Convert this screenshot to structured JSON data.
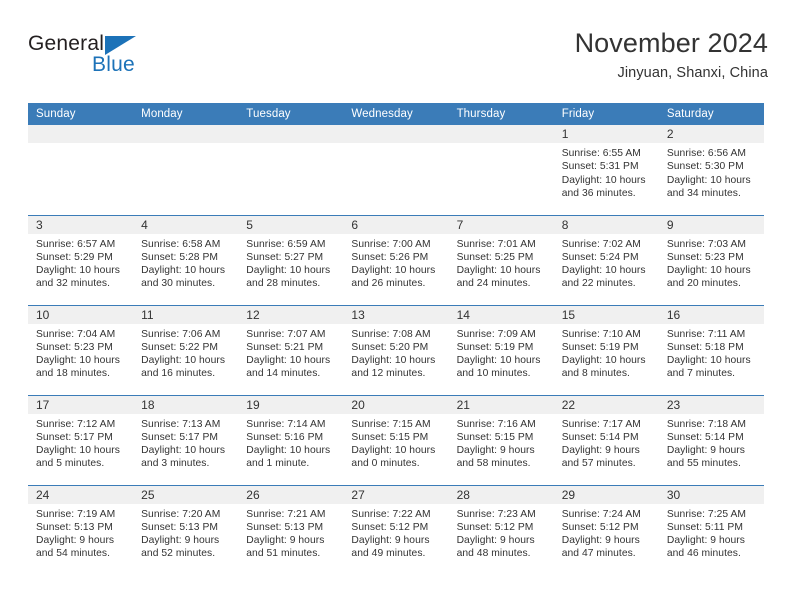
{
  "brand": {
    "name_part1": "General",
    "name_part2": "Blue",
    "flag_icon": "triangle-flag-icon",
    "colors": {
      "blue": "#1c72b8",
      "dark": "#231f20"
    }
  },
  "header": {
    "title": "November 2024",
    "subtitle": "Jinyuan, Shanxi, China"
  },
  "calendar": {
    "header_bg": "#3b7cb8",
    "daynum_bg": "#f0f0f0",
    "weekday_names": [
      "Sunday",
      "Monday",
      "Tuesday",
      "Wednesday",
      "Thursday",
      "Friday",
      "Saturday"
    ],
    "weeks": [
      [
        {
          "day": "",
          "sunrise": "",
          "sunset": "",
          "daylight": "",
          "empty": true
        },
        {
          "day": "",
          "sunrise": "",
          "sunset": "",
          "daylight": "",
          "empty": true
        },
        {
          "day": "",
          "sunrise": "",
          "sunset": "",
          "daylight": "",
          "empty": true
        },
        {
          "day": "",
          "sunrise": "",
          "sunset": "",
          "daylight": "",
          "empty": true
        },
        {
          "day": "",
          "sunrise": "",
          "sunset": "",
          "daylight": "",
          "empty": true
        },
        {
          "day": "1",
          "sunrise": "Sunrise: 6:55 AM",
          "sunset": "Sunset: 5:31 PM",
          "daylight": "Daylight: 10 hours and 36 minutes.",
          "empty": false
        },
        {
          "day": "2",
          "sunrise": "Sunrise: 6:56 AM",
          "sunset": "Sunset: 5:30 PM",
          "daylight": "Daylight: 10 hours and 34 minutes.",
          "empty": false
        }
      ],
      [
        {
          "day": "3",
          "sunrise": "Sunrise: 6:57 AM",
          "sunset": "Sunset: 5:29 PM",
          "daylight": "Daylight: 10 hours and 32 minutes.",
          "empty": false
        },
        {
          "day": "4",
          "sunrise": "Sunrise: 6:58 AM",
          "sunset": "Sunset: 5:28 PM",
          "daylight": "Daylight: 10 hours and 30 minutes.",
          "empty": false
        },
        {
          "day": "5",
          "sunrise": "Sunrise: 6:59 AM",
          "sunset": "Sunset: 5:27 PM",
          "daylight": "Daylight: 10 hours and 28 minutes.",
          "empty": false
        },
        {
          "day": "6",
          "sunrise": "Sunrise: 7:00 AM",
          "sunset": "Sunset: 5:26 PM",
          "daylight": "Daylight: 10 hours and 26 minutes.",
          "empty": false
        },
        {
          "day": "7",
          "sunrise": "Sunrise: 7:01 AM",
          "sunset": "Sunset: 5:25 PM",
          "daylight": "Daylight: 10 hours and 24 minutes.",
          "empty": false
        },
        {
          "day": "8",
          "sunrise": "Sunrise: 7:02 AM",
          "sunset": "Sunset: 5:24 PM",
          "daylight": "Daylight: 10 hours and 22 minutes.",
          "empty": false
        },
        {
          "day": "9",
          "sunrise": "Sunrise: 7:03 AM",
          "sunset": "Sunset: 5:23 PM",
          "daylight": "Daylight: 10 hours and 20 minutes.",
          "empty": false
        }
      ],
      [
        {
          "day": "10",
          "sunrise": "Sunrise: 7:04 AM",
          "sunset": "Sunset: 5:23 PM",
          "daylight": "Daylight: 10 hours and 18 minutes.",
          "empty": false
        },
        {
          "day": "11",
          "sunrise": "Sunrise: 7:06 AM",
          "sunset": "Sunset: 5:22 PM",
          "daylight": "Daylight: 10 hours and 16 minutes.",
          "empty": false
        },
        {
          "day": "12",
          "sunrise": "Sunrise: 7:07 AM",
          "sunset": "Sunset: 5:21 PM",
          "daylight": "Daylight: 10 hours and 14 minutes.",
          "empty": false
        },
        {
          "day": "13",
          "sunrise": "Sunrise: 7:08 AM",
          "sunset": "Sunset: 5:20 PM",
          "daylight": "Daylight: 10 hours and 12 minutes.",
          "empty": false
        },
        {
          "day": "14",
          "sunrise": "Sunrise: 7:09 AM",
          "sunset": "Sunset: 5:19 PM",
          "daylight": "Daylight: 10 hours and 10 minutes.",
          "empty": false
        },
        {
          "day": "15",
          "sunrise": "Sunrise: 7:10 AM",
          "sunset": "Sunset: 5:19 PM",
          "daylight": "Daylight: 10 hours and 8 minutes.",
          "empty": false
        },
        {
          "day": "16",
          "sunrise": "Sunrise: 7:11 AM",
          "sunset": "Sunset: 5:18 PM",
          "daylight": "Daylight: 10 hours and 7 minutes.",
          "empty": false
        }
      ],
      [
        {
          "day": "17",
          "sunrise": "Sunrise: 7:12 AM",
          "sunset": "Sunset: 5:17 PM",
          "daylight": "Daylight: 10 hours and 5 minutes.",
          "empty": false
        },
        {
          "day": "18",
          "sunrise": "Sunrise: 7:13 AM",
          "sunset": "Sunset: 5:17 PM",
          "daylight": "Daylight: 10 hours and 3 minutes.",
          "empty": false
        },
        {
          "day": "19",
          "sunrise": "Sunrise: 7:14 AM",
          "sunset": "Sunset: 5:16 PM",
          "daylight": "Daylight: 10 hours and 1 minute.",
          "empty": false
        },
        {
          "day": "20",
          "sunrise": "Sunrise: 7:15 AM",
          "sunset": "Sunset: 5:15 PM",
          "daylight": "Daylight: 10 hours and 0 minutes.",
          "empty": false
        },
        {
          "day": "21",
          "sunrise": "Sunrise: 7:16 AM",
          "sunset": "Sunset: 5:15 PM",
          "daylight": "Daylight: 9 hours and 58 minutes.",
          "empty": false
        },
        {
          "day": "22",
          "sunrise": "Sunrise: 7:17 AM",
          "sunset": "Sunset: 5:14 PM",
          "daylight": "Daylight: 9 hours and 57 minutes.",
          "empty": false
        },
        {
          "day": "23",
          "sunrise": "Sunrise: 7:18 AM",
          "sunset": "Sunset: 5:14 PM",
          "daylight": "Daylight: 9 hours and 55 minutes.",
          "empty": false
        }
      ],
      [
        {
          "day": "24",
          "sunrise": "Sunrise: 7:19 AM",
          "sunset": "Sunset: 5:13 PM",
          "daylight": "Daylight: 9 hours and 54 minutes.",
          "empty": false
        },
        {
          "day": "25",
          "sunrise": "Sunrise: 7:20 AM",
          "sunset": "Sunset: 5:13 PM",
          "daylight": "Daylight: 9 hours and 52 minutes.",
          "empty": false
        },
        {
          "day": "26",
          "sunrise": "Sunrise: 7:21 AM",
          "sunset": "Sunset: 5:13 PM",
          "daylight": "Daylight: 9 hours and 51 minutes.",
          "empty": false
        },
        {
          "day": "27",
          "sunrise": "Sunrise: 7:22 AM",
          "sunset": "Sunset: 5:12 PM",
          "daylight": "Daylight: 9 hours and 49 minutes.",
          "empty": false
        },
        {
          "day": "28",
          "sunrise": "Sunrise: 7:23 AM",
          "sunset": "Sunset: 5:12 PM",
          "daylight": "Daylight: 9 hours and 48 minutes.",
          "empty": false
        },
        {
          "day": "29",
          "sunrise": "Sunrise: 7:24 AM",
          "sunset": "Sunset: 5:12 PM",
          "daylight": "Daylight: 9 hours and 47 minutes.",
          "empty": false
        },
        {
          "day": "30",
          "sunrise": "Sunrise: 7:25 AM",
          "sunset": "Sunset: 5:11 PM",
          "daylight": "Daylight: 9 hours and 46 minutes.",
          "empty": false
        }
      ]
    ]
  }
}
